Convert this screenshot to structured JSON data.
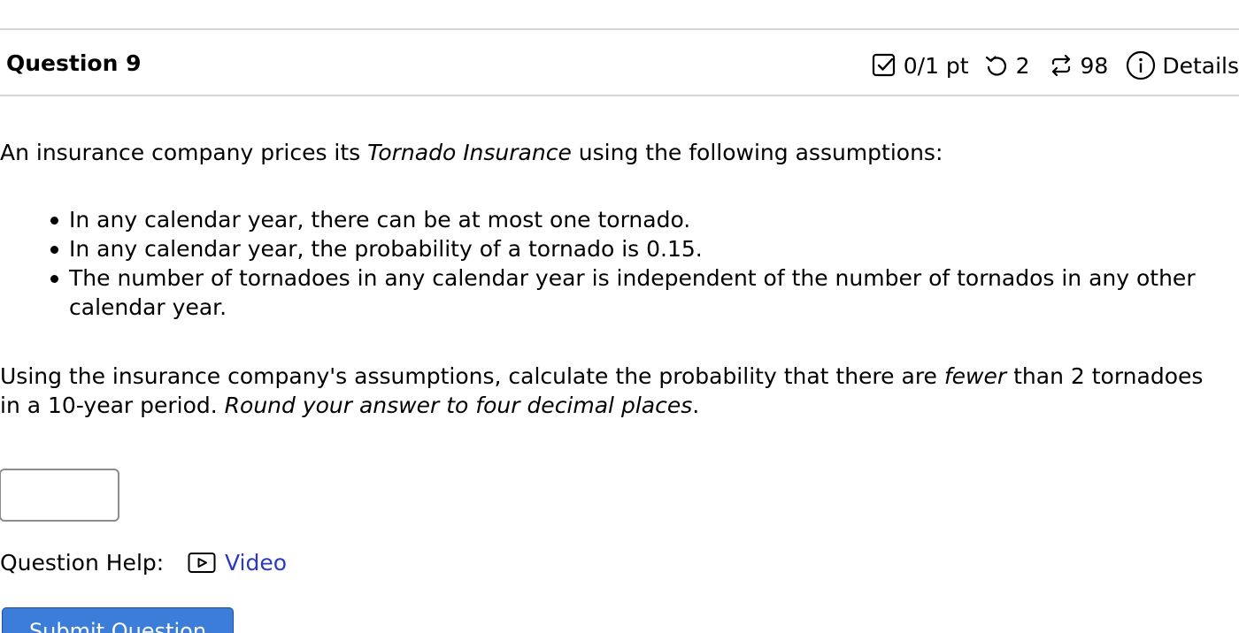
{
  "question": {
    "title": "Question 9"
  },
  "meta": {
    "score": "0/1 pt",
    "attempts": "2",
    "tries": "98",
    "details_label": "Details",
    "icons": {
      "score": "checkbox-icon",
      "attempts": "retry-icon",
      "tries": "repeat-icon",
      "details": "info-icon"
    }
  },
  "content": {
    "intro_before": "An insurance company prices its ",
    "intro_emphasis": "Tornado Insurance",
    "intro_after": " using the following assumptions:",
    "bullets": [
      "In any calendar year, there can be at most one tornado.",
      "In any calendar year, the probability of a tornado is 0.15.",
      "The number of tornadoes in any calendar year is independent of the number of tornados in any other",
      "calendar year."
    ],
    "question_line1_before": "Using the insurance company's assumptions, calculate the probability that there are ",
    "question_line1_emphasis": "fewer",
    "question_line1_after": " than 2 tornadoes",
    "question_line2_before": "in a 10-year period. ",
    "question_line2_emphasis": "Round your answer to four decimal places",
    "question_line2_after": "."
  },
  "answer": {
    "value": "",
    "placeholder": ""
  },
  "help": {
    "label": "Question Help:",
    "video_label": "Video",
    "video_icon": "video-icon",
    "link_color": "#2a3ac4"
  },
  "submit": {
    "label": "Submit Question",
    "color": "#3b7dd8"
  }
}
